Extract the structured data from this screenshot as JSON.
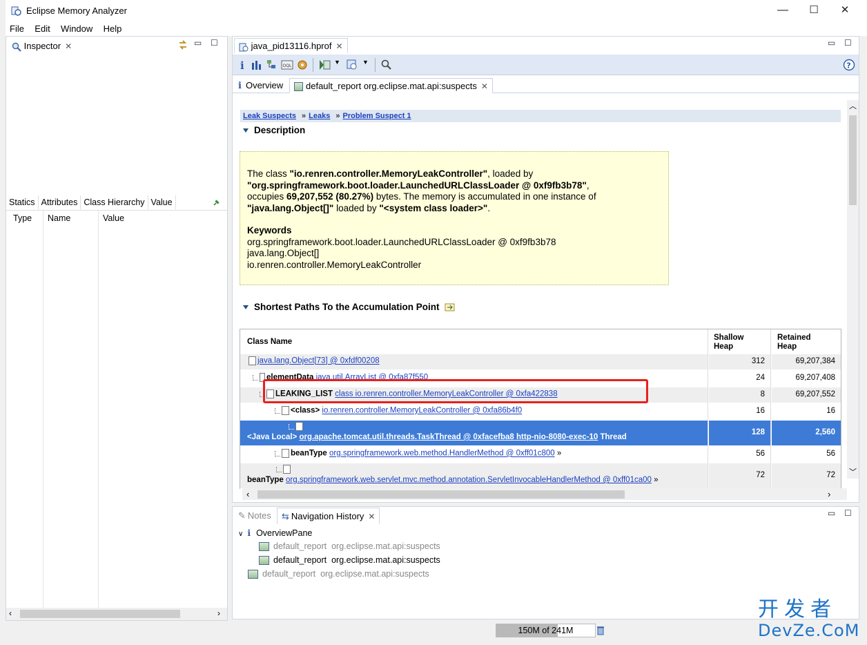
{
  "window": {
    "title": "Eclipse Memory Analyzer",
    "minimize": "—",
    "maximize": "☐",
    "close": "✕"
  },
  "menu": [
    "File",
    "Edit",
    "Window",
    "Help"
  ],
  "inspector": {
    "tab": "Inspector",
    "subtabs": [
      "Statics",
      "Attributes",
      "Class Hierarchy",
      "Value"
    ],
    "columns": [
      "Type",
      "Name",
      "Value"
    ]
  },
  "editor": {
    "file_tab": "java_pid13116.hprof",
    "page_tabs": [
      "Overview",
      "default_report  org.eclipse.mat.api:suspects"
    ],
    "breadcrumb": [
      "Leak Suspects",
      "Leaks",
      "Problem Suspect 1"
    ],
    "description_title": "Description",
    "description": {
      "p1": "The class ",
      "class_name": "\"io.renren.controller.MemoryLeakController\"",
      "p2": ", loaded by",
      "loader": "\"org.springframework.boot.loader.LaunchedURLClassLoader @ 0xf9fb3b78\"",
      "p3": ",",
      "p4": "occupies ",
      "bytes": "69,207,552 (80.27%)",
      "p5": " bytes. The memory is accumulated in one instance of",
      "instance": "\"java.lang.Object[]\"",
      "p6": " loaded by ",
      "sysloader": "\"<system class loader>\"",
      "p7": ".",
      "keywords_title": "Keywords",
      "keywords": [
        "org.springframework.boot.loader.LaunchedURLClassLoader @ 0xf9fb3b78",
        "java.lang.Object[]",
        "io.renren.controller.MemoryLeakController"
      ]
    },
    "paths_title": "Shortest Paths To the Accumulation Point",
    "table": {
      "headers": {
        "class_name": "Class Name",
        "shallow": "Shallow Heap",
        "retained": "Retained Heap"
      },
      "rows": [
        {
          "label": "",
          "link": "java.lang.Object[73] @ 0xfdf00208",
          "shallow": "312",
          "retained": "69,207,384"
        },
        {
          "label": "elementData",
          "link": "java.util.ArrayList @ 0xfa87f550",
          "shallow": "24",
          "retained": "69,207,408"
        },
        {
          "label": "LEAKING_LIST",
          "link": "class io.renren.controller.MemoryLeakController @ 0xfa422838",
          "shallow": "8",
          "retained": "69,207,552"
        },
        {
          "label": "<class>",
          "link": "io.renren.controller.MemoryLeakController @ 0xfa86b4f0",
          "shallow": "16",
          "retained": "16"
        },
        {
          "label": "<Java Local>",
          "link": "org.apache.tomcat.util.threads.TaskThread @ 0xfacefba8 http-nio-8080-exec-10",
          "suffix": " Thread",
          "shallow": "128",
          "retained": "2,560"
        },
        {
          "label": "beanType",
          "link": "org.springframework.web.method.HandlerMethod @ 0xff01c800",
          "suffix": " »",
          "shallow": "56",
          "retained": "56"
        },
        {
          "label": "beanType",
          "link": "org.springframework.web.servlet.mvc.method.annotation.ServletInvocableHandlerMethod @ 0xff01ca00",
          "suffix": " »",
          "shallow": "72",
          "retained": "72"
        }
      ]
    }
  },
  "bottom": {
    "tabs": [
      "Notes",
      "Navigation History"
    ],
    "history": [
      {
        "name": "OverviewPane",
        "detail": ""
      },
      {
        "name": "default_report",
        "detail": "org.eclipse.mat.api:suspects"
      },
      {
        "name": "default_report",
        "detail": "org.eclipse.mat.api:suspects"
      },
      {
        "name": "default_report",
        "detail": "org.eclipse.mat.api:suspects"
      }
    ]
  },
  "status": {
    "heap": "150M of 241M",
    "heap_fraction": 0.62
  },
  "watermark": {
    "line1": "开发者",
    "line2": "DevZe.CoM"
  },
  "colors": {
    "selection": "#3d7bd6",
    "highlight_box": "#e8201c",
    "description_bg": "#ffffdc"
  }
}
